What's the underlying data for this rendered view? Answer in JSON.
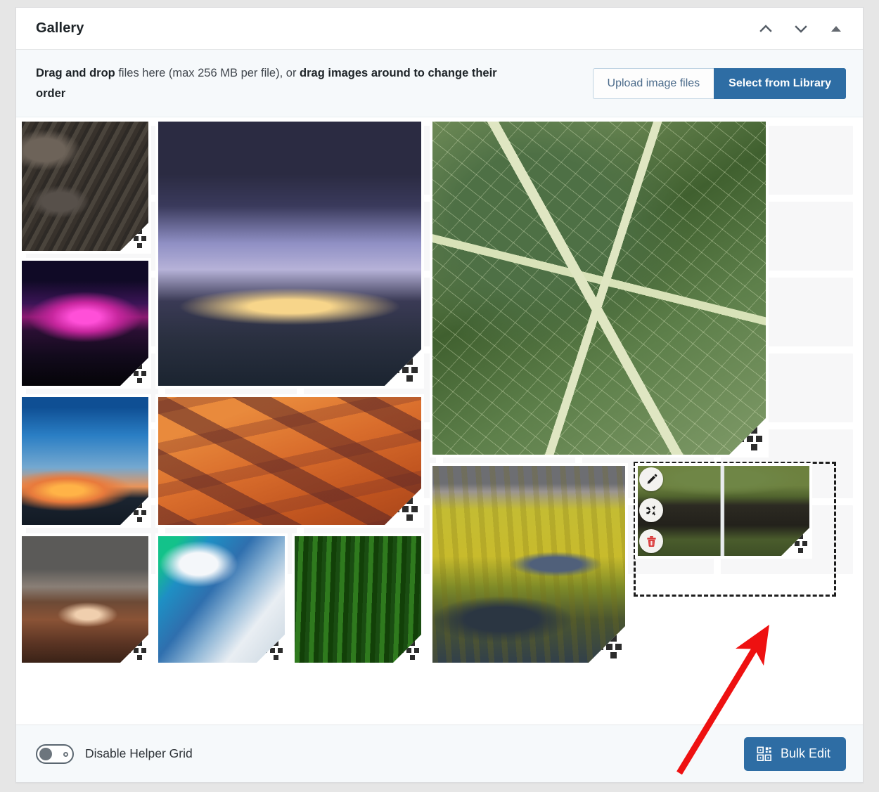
{
  "panel": {
    "title": "Gallery",
    "header_actions": [
      {
        "name": "move-up-icon",
        "label": "Move up"
      },
      {
        "name": "move-down-icon",
        "label": "Move down"
      },
      {
        "name": "collapse-icon",
        "label": "Collapse"
      }
    ]
  },
  "dropzone": {
    "text_bold_1": "Drag and drop",
    "text_plain_1": " files here (max 256 MB per file), or ",
    "text_bold_2": "drag images around to change their order",
    "max_file_size": "256 MB",
    "upload_button": "Upload image files",
    "library_button": "Select from Library"
  },
  "footer": {
    "toggle_label": "Disable Helper Grid",
    "toggle_state": "off",
    "bulk_edit_button": "Bulk Edit"
  },
  "overlay": {
    "edit_label": "Edit",
    "replace_label": "Replace",
    "delete_label": "Delete"
  },
  "colors": {
    "primary_blue": "#2e6da4",
    "secondary_text_blue": "#4a6a8a",
    "panel_border": "#dcdcde",
    "bar_background": "#f6f9fb",
    "helper_cell": "#f7f7f8",
    "annotation_red": "#ee1111",
    "delete_red": "#d83030"
  },
  "gallery": {
    "helper_cells": 36,
    "images": [
      {
        "id": "img-1",
        "alt": "Aerial canyon erosion patterns in desert sand"
      },
      {
        "id": "img-2",
        "alt": "Magenta aurora over still lake at night"
      },
      {
        "id": "img-3",
        "alt": "Palm tree silhouettes at tropical sunset"
      },
      {
        "id": "img-4",
        "alt": "Desert mesa buttes with lightning"
      },
      {
        "id": "img-5",
        "alt": "Green aurora over snowy mountain"
      },
      {
        "id": "img-6",
        "alt": "Mossy green forest with walking figure"
      },
      {
        "id": "img-7",
        "alt": "Lightning storm over city lights at dusk"
      },
      {
        "id": "img-8",
        "alt": "Orange sand dune ridges from above"
      },
      {
        "id": "img-9",
        "alt": "Macro close-up of green leaf veins"
      },
      {
        "id": "img-10",
        "alt": "Aerial meandering river through yellow marsh"
      },
      {
        "id": "img-11",
        "alt": "Waterfall over green cliff, selected"
      }
    ]
  }
}
